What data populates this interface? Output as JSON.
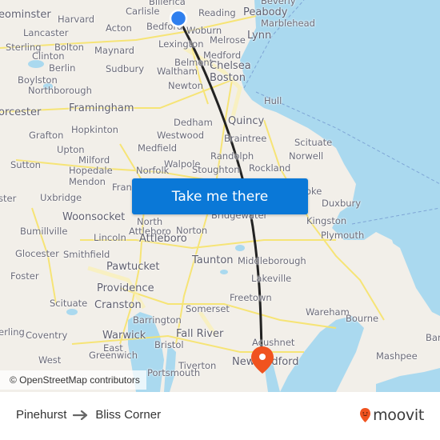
{
  "map": {
    "origin_marker": {
      "color": "#2f7fee"
    },
    "destination_marker": {
      "color": "#f0531f"
    },
    "route_color": "#222222",
    "water_color": "#aad9ef",
    "land_color": "#f2efe9",
    "labels": [
      {
        "text": "eominster",
        "major": true
      },
      {
        "text": "Harvard"
      },
      {
        "text": "Carlisle"
      },
      {
        "text": "Billerica"
      },
      {
        "text": "Reading"
      },
      {
        "text": "Peabody",
        "major": true
      },
      {
        "text": "Beverly"
      },
      {
        "text": "Marblehead"
      },
      {
        "text": "Lancaster"
      },
      {
        "text": "Acton"
      },
      {
        "text": "Bedford"
      },
      {
        "text": "Woburn"
      },
      {
        "text": "Melrose"
      },
      {
        "text": "Lynn",
        "major": true
      },
      {
        "text": "Sterling"
      },
      {
        "text": "Bolton"
      },
      {
        "text": "Maynard"
      },
      {
        "text": "Lexington"
      },
      {
        "text": "Clinton"
      },
      {
        "text": "Medford"
      },
      {
        "text": "Berlin"
      },
      {
        "text": "Sudbury"
      },
      {
        "text": "Belmont"
      },
      {
        "text": "Chelsea",
        "major": true
      },
      {
        "text": "Boylston"
      },
      {
        "text": "Waltham"
      },
      {
        "text": "Boston",
        "major": true
      },
      {
        "text": "Northborough"
      },
      {
        "text": "Newton"
      },
      {
        "text": "Hull"
      },
      {
        "text": "orcester",
        "major": true
      },
      {
        "text": "Framingham",
        "major": true
      },
      {
        "text": "Dedham"
      },
      {
        "text": "Quincy",
        "major": true
      },
      {
        "text": "Hopkinton"
      },
      {
        "text": "Grafton"
      },
      {
        "text": "Westwood"
      },
      {
        "text": "Braintree"
      },
      {
        "text": "Scituate"
      },
      {
        "text": "Upton"
      },
      {
        "text": "Medfield"
      },
      {
        "text": "Norwell"
      },
      {
        "text": "Randolph"
      },
      {
        "text": "Sutton"
      },
      {
        "text": "Milford"
      },
      {
        "text": "Walpole"
      },
      {
        "text": "Hopedale"
      },
      {
        "text": "Norfolk"
      },
      {
        "text": "Stoughton"
      },
      {
        "text": "Rockland"
      },
      {
        "text": "Mendon"
      },
      {
        "text": "Fran"
      },
      {
        "text": "Uxbridge"
      },
      {
        "text": "ster"
      },
      {
        "text": "oke"
      },
      {
        "text": "Duxbury"
      },
      {
        "text": "Woonsocket",
        "major": true
      },
      {
        "text": "North"
      },
      {
        "text": "Attleboro"
      },
      {
        "text": "Bridgewater"
      },
      {
        "text": "Kingston"
      },
      {
        "text": "Bumillville"
      },
      {
        "text": "Norton"
      },
      {
        "text": "Lincoln"
      },
      {
        "text": "Attleboro",
        "major": true
      },
      {
        "text": "Plymouth"
      },
      {
        "text": "Glocester"
      },
      {
        "text": "Smithfield"
      },
      {
        "text": "Taunton",
        "major": true
      },
      {
        "text": "Middleborough"
      },
      {
        "text": "Pawtucket",
        "major": true
      },
      {
        "text": "Foster"
      },
      {
        "text": "Lakeville"
      },
      {
        "text": "Providence",
        "major": true
      },
      {
        "text": "Freetown"
      },
      {
        "text": "Scituate"
      },
      {
        "text": "Cranston",
        "major": true
      },
      {
        "text": "Somerset"
      },
      {
        "text": "Wareham"
      },
      {
        "text": "Barrington"
      },
      {
        "text": "Bourne"
      },
      {
        "text": "erling"
      },
      {
        "text": "Coventry"
      },
      {
        "text": "Warwick",
        "major": true
      },
      {
        "text": "Fall River",
        "major": true
      },
      {
        "text": "Bristol"
      },
      {
        "text": "Acushnet"
      },
      {
        "text": "Bar"
      },
      {
        "text": "East"
      },
      {
        "text": "Greenwich"
      },
      {
        "text": "Mashpee"
      },
      {
        "text": "New Bedford",
        "major": true
      },
      {
        "text": "West"
      },
      {
        "text": "Tiverton"
      },
      {
        "text": "Portsmouth"
      }
    ],
    "attribution": "© OpenStreetMap contributors"
  },
  "cta": {
    "label": "Take me there",
    "color": "#0a78d7"
  },
  "footer": {
    "origin": "Pinehurst",
    "destination": "Bliss Corner",
    "arrow": "→",
    "brand": "moovit",
    "brand_color": "#f0531f"
  }
}
